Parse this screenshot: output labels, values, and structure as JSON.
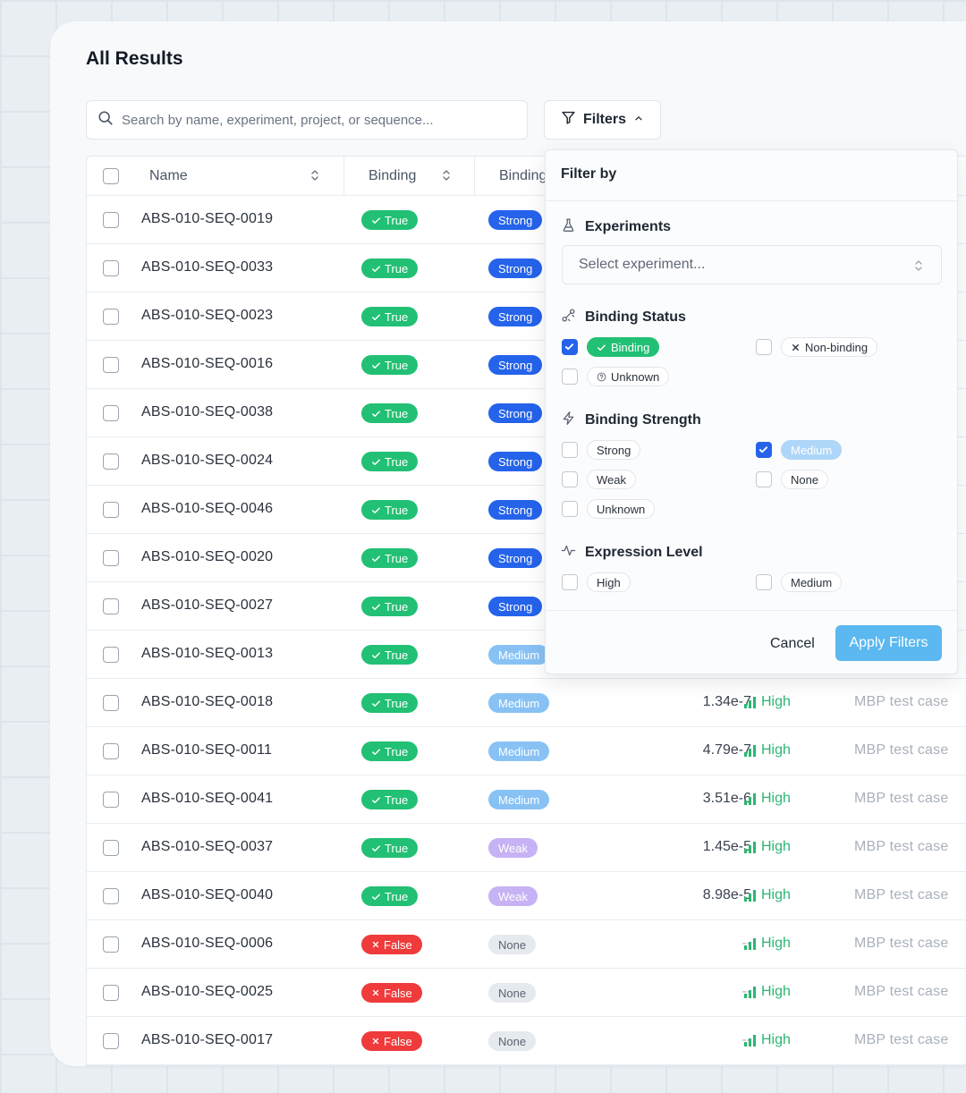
{
  "page": {
    "title": "All Results"
  },
  "search": {
    "placeholder": "Search by name, experiment, project, or sequence..."
  },
  "filters_button": {
    "label": "Filters"
  },
  "table": {
    "headers": {
      "name": "Name",
      "binding": "Binding",
      "binding_strength": "Binding"
    },
    "rows": [
      {
        "name": "ABS-010-SEQ-0019",
        "binding": "True",
        "strength": "Strong",
        "kd": "",
        "expression": "",
        "project": ""
      },
      {
        "name": "ABS-010-SEQ-0033",
        "binding": "True",
        "strength": "Strong",
        "kd": "",
        "expression": "",
        "project": ""
      },
      {
        "name": "ABS-010-SEQ-0023",
        "binding": "True",
        "strength": "Strong",
        "kd": "",
        "expression": "",
        "project": ""
      },
      {
        "name": "ABS-010-SEQ-0016",
        "binding": "True",
        "strength": "Strong",
        "kd": "",
        "expression": "",
        "project": ""
      },
      {
        "name": "ABS-010-SEQ-0038",
        "binding": "True",
        "strength": "Strong",
        "kd": "",
        "expression": "",
        "project": ""
      },
      {
        "name": "ABS-010-SEQ-0024",
        "binding": "True",
        "strength": "Strong",
        "kd": "",
        "expression": "",
        "project": ""
      },
      {
        "name": "ABS-010-SEQ-0046",
        "binding": "True",
        "strength": "Strong",
        "kd": "",
        "expression": "",
        "project": ""
      },
      {
        "name": "ABS-010-SEQ-0020",
        "binding": "True",
        "strength": "Strong",
        "kd": "",
        "expression": "",
        "project": ""
      },
      {
        "name": "ABS-010-SEQ-0027",
        "binding": "True",
        "strength": "Strong",
        "kd": "",
        "expression": "",
        "project": ""
      },
      {
        "name": "ABS-010-SEQ-0013",
        "binding": "True",
        "strength": "Medium",
        "kd": "",
        "expression": "",
        "project": ""
      },
      {
        "name": "ABS-010-SEQ-0018",
        "binding": "True",
        "strength": "Medium",
        "kd": "1.34e-7",
        "expression": "High",
        "project": "MBP test case"
      },
      {
        "name": "ABS-010-SEQ-0011",
        "binding": "True",
        "strength": "Medium",
        "kd": "4.79e-7",
        "expression": "High",
        "project": "MBP test case"
      },
      {
        "name": "ABS-010-SEQ-0041",
        "binding": "True",
        "strength": "Medium",
        "kd": "3.51e-6",
        "expression": "High",
        "project": "MBP test case"
      },
      {
        "name": "ABS-010-SEQ-0037",
        "binding": "True",
        "strength": "Weak",
        "kd": "1.45e-5",
        "expression": "High",
        "project": "MBP test case"
      },
      {
        "name": "ABS-010-SEQ-0040",
        "binding": "True",
        "strength": "Weak",
        "kd": "8.98e-5",
        "expression": "High",
        "project": "MBP test case"
      },
      {
        "name": "ABS-010-SEQ-0006",
        "binding": "False",
        "strength": "None",
        "kd": "--",
        "expression": "High",
        "project": "MBP test case"
      },
      {
        "name": "ABS-010-SEQ-0025",
        "binding": "False",
        "strength": "None",
        "kd": "--",
        "expression": "High",
        "project": "MBP test case"
      },
      {
        "name": "ABS-010-SEQ-0017",
        "binding": "False",
        "strength": "None",
        "kd": "--",
        "expression": "High",
        "project": "MBP test case"
      }
    ]
  },
  "filter_panel": {
    "title": "Filter by",
    "experiments": {
      "label": "Experiments",
      "select_placeholder": "Select experiment..."
    },
    "binding_status": {
      "label": "Binding Status",
      "options": [
        {
          "label": "Binding",
          "checked": true
        },
        {
          "label": "Non-binding",
          "checked": false
        },
        {
          "label": "Unknown",
          "checked": false
        }
      ]
    },
    "binding_strength": {
      "label": "Binding Strength",
      "options": [
        {
          "label": "Strong",
          "checked": false
        },
        {
          "label": "Medium",
          "checked": true
        },
        {
          "label": "Weak",
          "checked": false
        },
        {
          "label": "None",
          "checked": false
        },
        {
          "label": "Unknown",
          "checked": false
        }
      ]
    },
    "expression_level": {
      "label": "Expression Level",
      "options": [
        {
          "label": "High",
          "checked": false
        },
        {
          "label": "Medium",
          "checked": false
        }
      ]
    },
    "cancel_label": "Cancel",
    "apply_label": "Apply Filters"
  },
  "colors": {
    "true_green": "#22c074",
    "false_red": "#ef3b3b",
    "strong_blue": "#2563eb",
    "medium_blue": "#88c2f4",
    "weak_purple": "#c6b2f4",
    "expression_green": "#2bb673",
    "apply_button": "#5bb8f0"
  }
}
